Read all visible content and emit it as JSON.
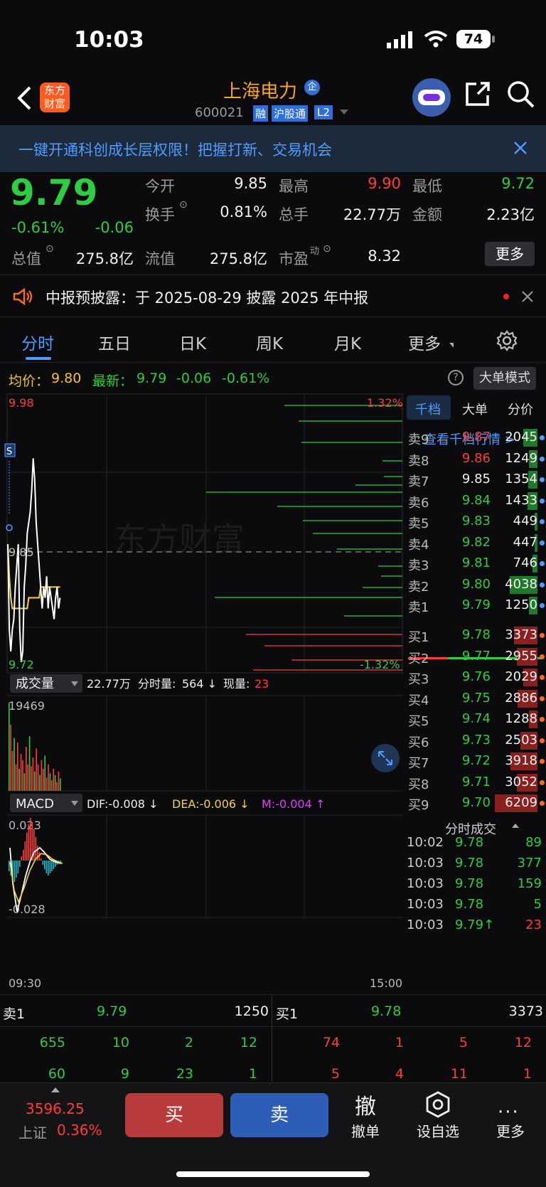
{
  "status_bar": {
    "time": "10:03",
    "battery": "74"
  },
  "header": {
    "logo_line1": "东方",
    "logo_line2": "财富",
    "stock_name": "上海电力",
    "stock_badge": "企",
    "stock_code": "600021",
    "tag_margin": "融",
    "tag_connect": "沪股通",
    "tag_level": "L2"
  },
  "banner": {
    "text": "一键开通科创成长层权限！把握打新、交易机会"
  },
  "quote": {
    "price": "9.79",
    "change_pct": "-0.61%",
    "change": "-0.06",
    "open_label": "今开",
    "open": "9.85",
    "high_label": "最高",
    "high": "9.90",
    "low_label": "最低",
    "low": "9.72",
    "turnover_label": "换手",
    "turnover": "0.81%",
    "volume_label": "总手",
    "volume": "22.77万",
    "amount_label": "金额",
    "amount": "2.23亿",
    "mktcap_label": "总值",
    "mktcap": "275.8亿",
    "float_label": "流值",
    "float": "275.8亿",
    "pe_label": "市盈",
    "pe_sup": "动",
    "pe": "8.32",
    "more": "更多"
  },
  "notice": {
    "text": "中报预披露：于 2025-08-29 披露 2025 年中报"
  },
  "tabs": [
    "分时",
    "五日",
    "日K",
    "周K",
    "月K",
    "更多"
  ],
  "avg_line": {
    "avg_label": "均价：",
    "avg": "9.80",
    "last_label": "最新：",
    "last": "9.79",
    "chg": "-0.06",
    "pct": "-0.61%",
    "mode_btn": "大单模式"
  },
  "chart": {
    "y_top": "9.98",
    "y_mid": "9.85",
    "y_bot": "9.72",
    "pct_top": "1.32%",
    "pct_bot": "-1.32%",
    "watermark": "东方财富",
    "vol_label": "成交量",
    "vol_total": "22.77万",
    "vol_min_label": "分时量:",
    "vol_min": "564 ↓",
    "vol_now_label": "现量:",
    "vol_now": "23",
    "vol_max": "19469",
    "macd_label": "MACD",
    "dif": "DIF:-0.008 ↓",
    "dea": "DEA:-0.006 ↓",
    "m": "M:-0.004 ↑",
    "macd_top": "0.023",
    "macd_bot": "-0.028",
    "t_start": "09:30",
    "t_end": "15:00",
    "price_series": [
      9.84,
      9.76,
      9.74,
      9.76,
      9.77,
      9.8,
      9.82,
      9.84,
      9.76,
      9.73,
      9.74,
      9.8,
      9.82,
      9.85,
      9.86,
      9.87,
      9.89,
      9.92,
      9.9,
      9.86,
      9.84,
      9.82,
      9.8,
      9.78,
      9.8,
      9.79,
      9.81,
      9.78,
      9.8,
      9.79,
      9.78,
      9.77,
      9.79,
      9.8,
      9.78,
      9.79
    ],
    "avg_series": [
      9.84,
      9.81,
      9.79,
      9.78,
      9.78,
      9.78,
      9.78,
      9.78,
      9.78,
      9.78,
      9.78,
      9.78,
      9.78,
      9.78,
      9.79,
      9.79,
      9.79,
      9.79,
      9.79,
      9.79,
      9.79,
      9.79,
      9.8,
      9.8,
      9.8,
      9.8,
      9.8,
      9.8,
      9.8,
      9.8,
      9.8,
      9.8,
      9.8,
      9.8,
      9.8,
      9.8
    ]
  },
  "order_book": {
    "tab_thousand": "千档",
    "tab_big": "大单",
    "tab_split": "分价",
    "view_link": "查看千档行情 >",
    "asks": [
      {
        "label": "卖9",
        "price": "9.87",
        "vol": "2045"
      },
      {
        "label": "卖8",
        "price": "9.86",
        "vol": "1249"
      },
      {
        "label": "卖7",
        "price": "9.85",
        "vol": "1354"
      },
      {
        "label": "卖6",
        "price": "9.84",
        "vol": "1433"
      },
      {
        "label": "卖5",
        "price": "9.83",
        "vol": "449"
      },
      {
        "label": "卖4",
        "price": "9.82",
        "vol": "447"
      },
      {
        "label": "卖3",
        "price": "9.81",
        "vol": "746"
      },
      {
        "label": "卖2",
        "price": "9.80",
        "vol": "4038"
      },
      {
        "label": "卖1",
        "price": "9.79",
        "vol": "1250"
      }
    ],
    "bids": [
      {
        "label": "买1",
        "price": "9.78",
        "vol": "3373"
      },
      {
        "label": "买2",
        "price": "9.77",
        "vol": "2955"
      },
      {
        "label": "买3",
        "price": "9.76",
        "vol": "2029"
      },
      {
        "label": "买4",
        "price": "9.75",
        "vol": "2886"
      },
      {
        "label": "买5",
        "price": "9.74",
        "vol": "1288"
      },
      {
        "label": "买6",
        "price": "9.73",
        "vol": "2503"
      },
      {
        "label": "买7",
        "price": "9.72",
        "vol": "3918"
      },
      {
        "label": "买8",
        "price": "9.71",
        "vol": "3052"
      },
      {
        "label": "买9",
        "price": "9.70",
        "vol": "6209"
      }
    ],
    "ticks_title": "分时成交",
    "ticks": [
      {
        "time": "10:02",
        "price": "9.78",
        "vol": "89"
      },
      {
        "time": "10:03",
        "price": "9.78",
        "vol": "377"
      },
      {
        "time": "10:03",
        "price": "9.78",
        "vol": "159"
      },
      {
        "time": "10:03",
        "price": "9.78",
        "vol": "5"
      },
      {
        "time": "10:03",
        "price": "9.79↑",
        "vol": "23"
      }
    ]
  },
  "bottom_quote": {
    "sell_label": "卖1",
    "sell_price": "9.79",
    "sell_vol": "1250",
    "buy_label": "买1",
    "buy_price": "9.78",
    "buy_vol": "3373",
    "sell_row1": [
      "655",
      "10",
      "2",
      "12"
    ],
    "sell_row2": [
      "60",
      "9",
      "23",
      "1"
    ],
    "buy_row1": [
      "74",
      "1",
      "5",
      "12"
    ],
    "buy_row2": [
      "5",
      "4",
      "11",
      "1"
    ]
  },
  "footer": {
    "index_value": "3596.25",
    "index_name": "上证",
    "index_pct": "0.36%",
    "buy": "买",
    "sell": "卖",
    "cancel_icon": "撤",
    "cancel": "撤单",
    "watch": "设自选",
    "more": "更多"
  }
}
